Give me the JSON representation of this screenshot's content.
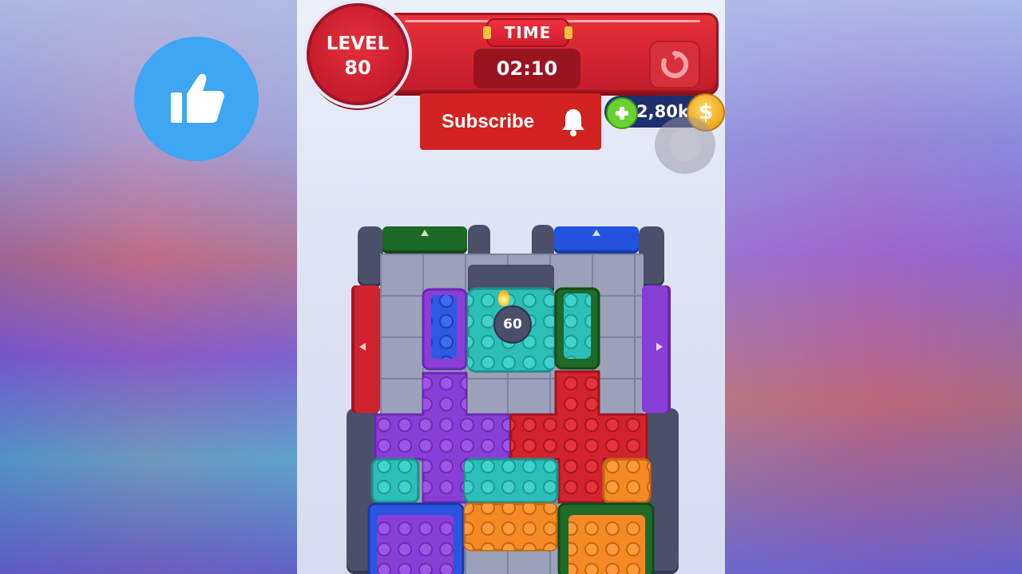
{
  "hud": {
    "level_label": "LEVEL",
    "level_number": "80",
    "time_label": "TIME",
    "time_value": "02:10",
    "restart_icon": "restart-icon",
    "coins": "2,80k",
    "coin_icon": "$"
  },
  "overlay": {
    "subscribe_label": "Subscribe",
    "bell_icon": "bell-icon",
    "like_icon": "thumbs-up-icon"
  },
  "board": {
    "bomb_counter": "60",
    "colors": {
      "red": "#d3232f",
      "purple": "#8a3fd8",
      "teal": "#2cbeb8",
      "blue": "#2a55e0",
      "green": "#1f6a28",
      "orange": "#f58a25",
      "wall": "#4b5068"
    }
  }
}
